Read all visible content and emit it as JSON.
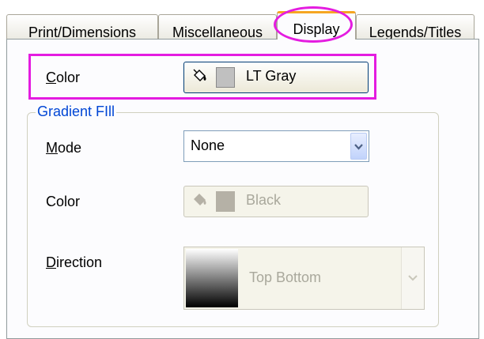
{
  "tabs": [
    {
      "label": "Print/Dimensions"
    },
    {
      "label": "Miscellaneous"
    },
    {
      "label": "Display"
    },
    {
      "label": "Legends/Titles"
    }
  ],
  "display": {
    "color_label_prefix": "C",
    "color_label_rest": "olor",
    "color_value": "LT Gray",
    "color_swatch": "#c0c0c0",
    "gradient_group_title": "Gradient FIll",
    "mode_label_prefix": "M",
    "mode_label_rest": "ode",
    "mode_value": "None",
    "gradient_color_label": "Color",
    "gradient_color_value": "Black",
    "gradient_color_swatch": "#b5b1a6",
    "direction_label_prefix": "D",
    "direction_label_rest": "irection",
    "direction_value": "Top Bottom"
  },
  "colors": {
    "highlight": "#e41ce0",
    "group_title": "#0046d5",
    "active_tab_accent": "#f5a623"
  },
  "icons": [
    "paint-bucket-icon",
    "paint-bucket-icon",
    "chevron-down-icon"
  ]
}
